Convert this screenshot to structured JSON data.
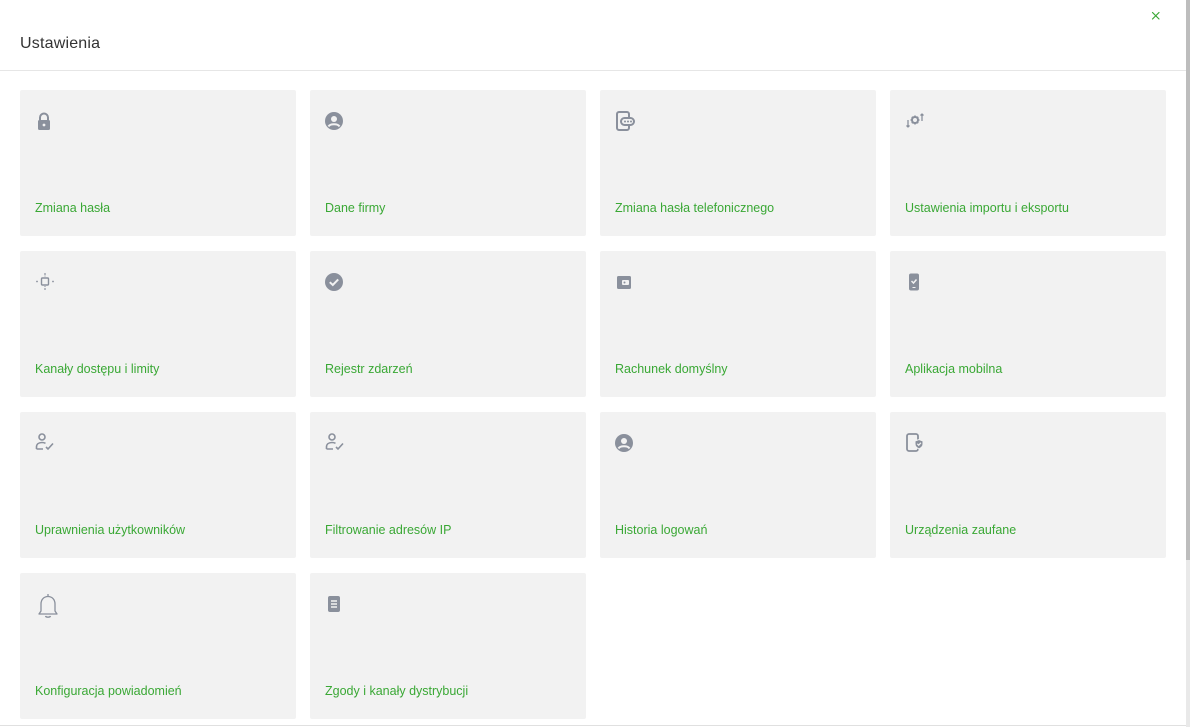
{
  "header": {
    "title": "Ustawienia",
    "close_label": "×"
  },
  "tiles": [
    {
      "label": "Zmiana hasła",
      "icon": "lock-icon"
    },
    {
      "label": "Dane firmy",
      "icon": "user-circle-icon"
    },
    {
      "label": "Zmiana hasła telefonicznego",
      "icon": "phone-password-icon"
    },
    {
      "label": "Ustawienia importu i eksportu",
      "icon": "import-export-settings-icon"
    },
    {
      "label": "Kanały dostępu i limity",
      "icon": "access-channels-icon"
    },
    {
      "label": "Rejestr zdarzeń",
      "icon": "check-circle-icon"
    },
    {
      "label": "Rachunek domyślny",
      "icon": "wallet-icon"
    },
    {
      "label": "Aplikacja mobilna",
      "icon": "mobile-app-icon"
    },
    {
      "label": "Uprawnienia użytkowników",
      "icon": "user-check-icon"
    },
    {
      "label": "Filtrowanie adresów IP",
      "icon": "user-check-icon"
    },
    {
      "label": "Historia logowań",
      "icon": "user-circle-icon"
    },
    {
      "label": "Urządzenia zaufane",
      "icon": "trusted-device-icon"
    },
    {
      "label": "Konfiguracja powiadomień",
      "icon": "bell-icon"
    },
    {
      "label": "Zgody i kanały dystrybucji",
      "icon": "document-icon"
    }
  ],
  "colors": {
    "accent": "#3aa835",
    "tile_bg": "#f2f2f2",
    "icon": "#8a909c"
  }
}
